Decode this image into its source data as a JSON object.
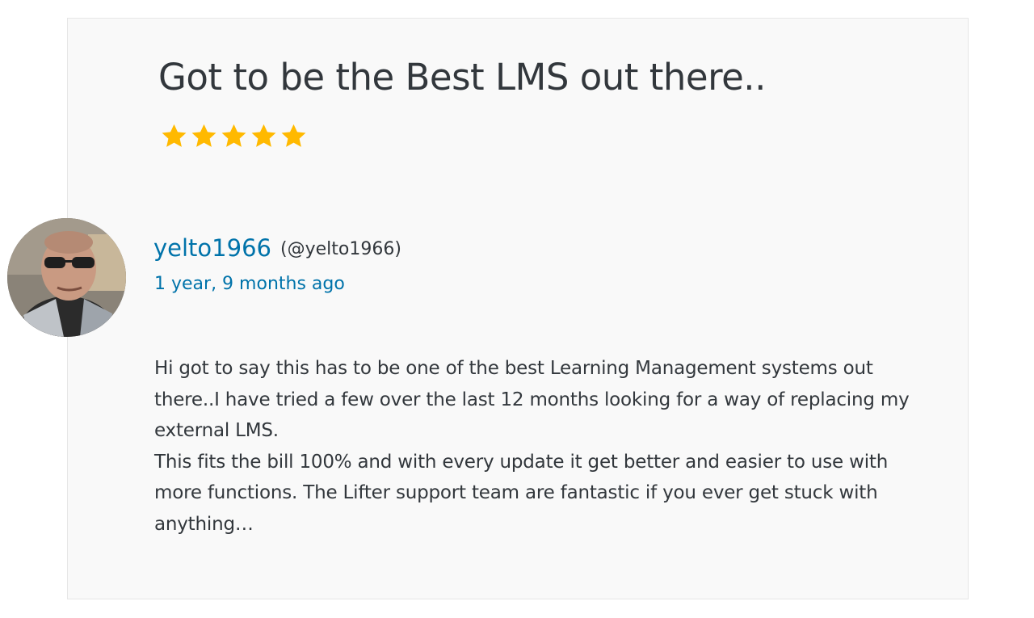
{
  "review": {
    "title": "Got to be the Best LMS out there..",
    "rating": 5,
    "rating_max": 5,
    "star_color": "#ffb900",
    "author": {
      "display_name": "yelto1966",
      "handle": "(@yelto1966)",
      "avatar_icon": "user-avatar-photo"
    },
    "date": "1 year, 9 months ago",
    "body": {
      "paragraph_1": "Hi got to say this has to be one of the best Learning Management systems out there..I have tried a few over the last 12 months looking for a way of replacing my external LMS.",
      "paragraph_2": "This fits the bill 100% and with every update it get better and easier to use with more functions. The Lifter support team are fantastic if you ever get stuck with anything…"
    }
  },
  "colors": {
    "link": "#0073aa",
    "text": "#32373c",
    "card_background": "#f9f9f9",
    "card_border": "#e6e6e6"
  }
}
